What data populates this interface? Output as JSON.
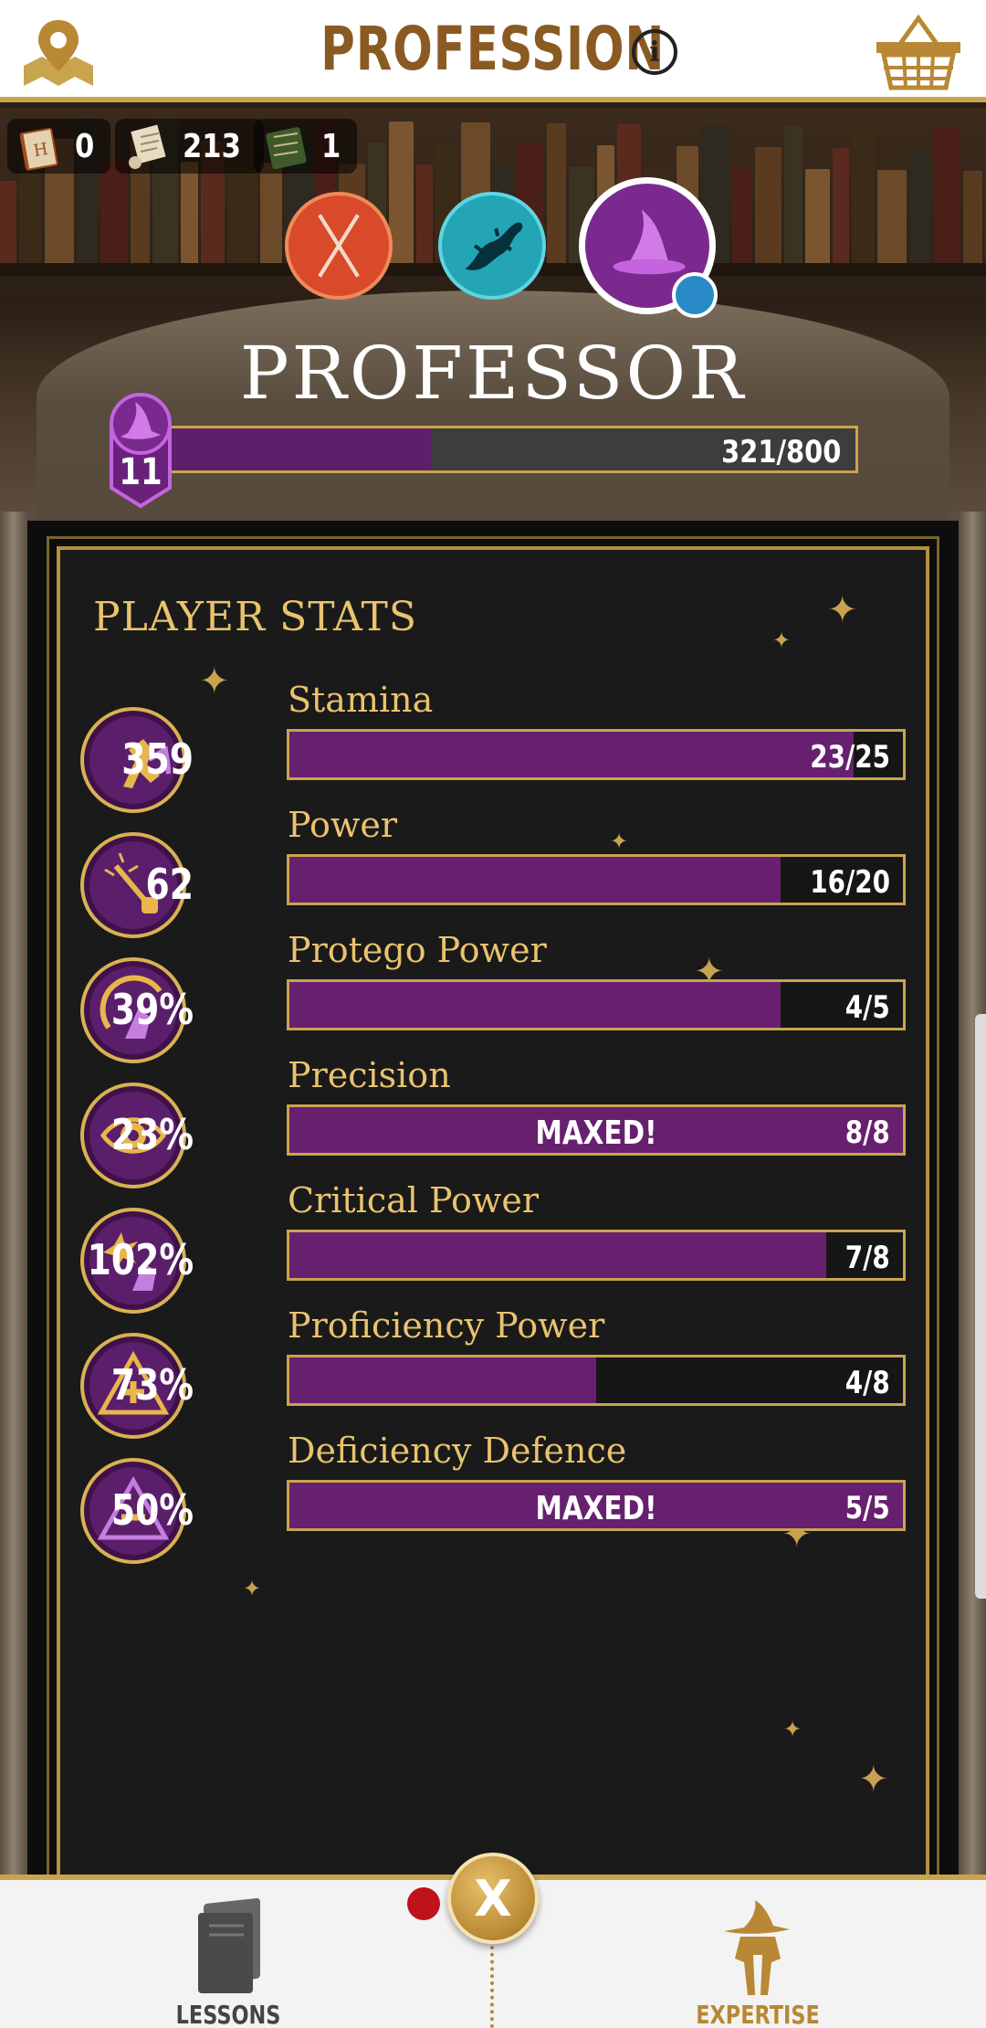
{
  "header": {
    "title": "PROFESSION",
    "icons": {
      "left": "map-pin-icon",
      "info": "info-icon",
      "right": "basket-icon"
    },
    "info_glyph": "i"
  },
  "currencies": [
    {
      "icon": "spell-book-icon",
      "value": "0"
    },
    {
      "icon": "scroll-icon",
      "value": "213"
    },
    {
      "icon": "restricted-book-icon",
      "value": "1"
    }
  ],
  "professions": [
    {
      "name": "auror",
      "icon": "crossed-wands-icon",
      "color": "#e0562e"
    },
    {
      "name": "magizoologist",
      "icon": "salamander-icon",
      "color": "#2bb3c4"
    },
    {
      "name": "professor",
      "icon": "wizard-hat-icon",
      "color": "#b24ad0",
      "selected": true
    }
  ],
  "rank": {
    "title": "PROFESSOR",
    "level": "11",
    "xp_text": "321/800",
    "xp_fraction": 0.401
  },
  "stats_panel": {
    "title": "PLAYER STATS",
    "stats": [
      {
        "name": "Stamina",
        "value": "359",
        "count": "23/25",
        "fraction": 0.92,
        "maxed": "",
        "icon": "stamina-icon"
      },
      {
        "name": "Power",
        "value": "62",
        "count": "16/20",
        "fraction": 0.8,
        "maxed": "",
        "icon": "power-wand-icon"
      },
      {
        "name": "Protego Power",
        "value": "39%",
        "count": "4/5",
        "fraction": 0.8,
        "maxed": "",
        "icon": "protego-icon"
      },
      {
        "name": "Precision",
        "value": "23%",
        "count": "8/8",
        "fraction": 1.0,
        "maxed": "MAXED!",
        "icon": "precision-eye-icon"
      },
      {
        "name": "Critical Power",
        "value": "102%",
        "count": "7/8",
        "fraction": 0.875,
        "maxed": "",
        "icon": "critical-power-icon"
      },
      {
        "name": "Proficiency Power",
        "value": "73%",
        "count": "4/8",
        "fraction": 0.5,
        "maxed": "",
        "icon": "proficiency-plus-icon"
      },
      {
        "name": "Deficiency Defence",
        "value": "50%",
        "count": "5/5",
        "fraction": 1.0,
        "maxed": "MAXED!",
        "icon": "deficiency-minus-icon"
      }
    ]
  },
  "bottom_nav": {
    "lessons_label": "LESSONS",
    "expertise_label": "EXPERTISE",
    "close_label": "X",
    "lessons_color": "#444444",
    "expertise_color": "#b88835"
  }
}
